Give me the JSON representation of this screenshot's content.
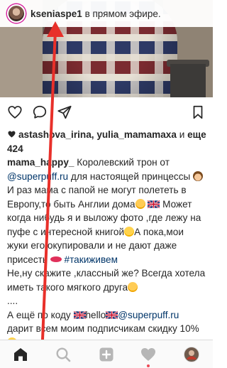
{
  "live_banner": {
    "username": "kseniaspe1",
    "text": " в прямом эфире."
  },
  "likes": {
    "users": "astashova_irina, yulia_mamamaxa",
    "connector": " и ",
    "more": "еще 424"
  },
  "caption": {
    "author": "mama_happy_",
    "part1": " Королевский трон от ",
    "mention1": "@superpuff.ru",
    "part2": " для настоящей принцессы ",
    "part3": "И раз  мама с папой не могут полететь в Европу,то быть Англии дома",
    "part4": " Может когда нибудь я  и выложу фото ,где лежу на пуфе с интересной книгой",
    "part5": "А пока,мои жуки его окупировали и не дают даже присесть",
    "hashtag": "#такиживем",
    "part6": "Не,ну скажите ,классный же? Всегда хотела иметь такого мягкого друга",
    "part7": "....",
    "part8": "А ещё  по коду ",
    "code": "hello",
    "mention2": "@superpuff.ru",
    "part9": "дарит  всем моим  подписчикам скидку 10% "
  },
  "icons": {
    "like": "heart-outline-icon",
    "comment": "comment-icon",
    "share": "direct-share-icon",
    "bookmark": "bookmark-icon",
    "home": "home-icon",
    "search": "search-icon",
    "add": "add-post-icon",
    "activity": "activity-heart-icon",
    "profile": "profile-avatar-icon"
  },
  "colors": {
    "link": "#003569",
    "annotation_arrow": "#e8302a",
    "notification_dot": "#ed4956"
  }
}
